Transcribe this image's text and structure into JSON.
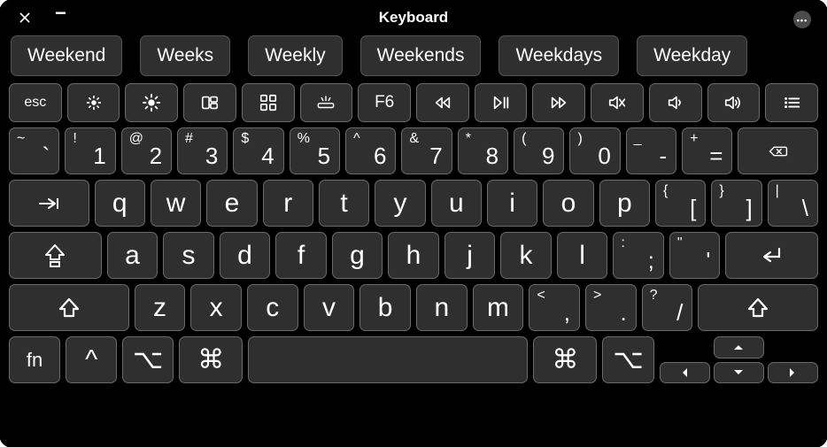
{
  "window": {
    "title": "Keyboard"
  },
  "suggestions": [
    "Weekend",
    "Weeks",
    "Weekly",
    "Weekends",
    "Weekdays",
    "Weekday"
  ],
  "fn_row": {
    "esc": "esc",
    "f6": "F6"
  },
  "number_row": [
    {
      "upper": "~",
      "lower": "`"
    },
    {
      "upper": "!",
      "lower": "1"
    },
    {
      "upper": "@",
      "lower": "2"
    },
    {
      "upper": "#",
      "lower": "3"
    },
    {
      "upper": "$",
      "lower": "4"
    },
    {
      "upper": "%",
      "lower": "5"
    },
    {
      "upper": "^",
      "lower": "6"
    },
    {
      "upper": "&",
      "lower": "7"
    },
    {
      "upper": "*",
      "lower": "8"
    },
    {
      "upper": "(",
      "lower": "9"
    },
    {
      "upper": ")",
      "lower": "0"
    },
    {
      "upper": "_",
      "lower": "-"
    },
    {
      "upper": "+",
      "lower": "="
    }
  ],
  "qwerty_row": [
    "q",
    "w",
    "e",
    "r",
    "t",
    "y",
    "u",
    "i",
    "o",
    "p"
  ],
  "bracket1": {
    "upper": "{",
    "lower": "["
  },
  "bracket2": {
    "upper": "}",
    "lower": "]"
  },
  "backslash": {
    "upper": "|",
    "lower": "\\"
  },
  "asdf_row": [
    "a",
    "s",
    "d",
    "f",
    "g",
    "h",
    "j",
    "k",
    "l"
  ],
  "semicolon": {
    "upper": ":",
    "lower": ";"
  },
  "quote": {
    "upper": "\"",
    "lower": "'"
  },
  "zxcv_row": [
    "z",
    "x",
    "c",
    "v",
    "b",
    "n",
    "m"
  ],
  "comma": {
    "upper": "<",
    "lower": ","
  },
  "period": {
    "upper": ">",
    "lower": "."
  },
  "slash": {
    "upper": "?",
    "lower": "/"
  },
  "bottom": {
    "fn": "fn",
    "control": "^",
    "option": "⌥",
    "command": "⌘"
  }
}
